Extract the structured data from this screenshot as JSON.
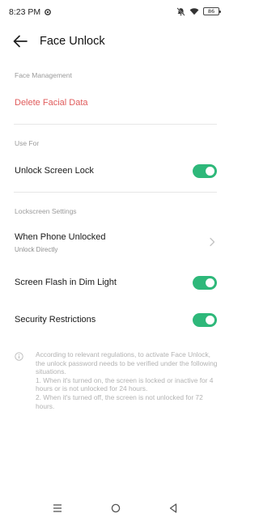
{
  "status_bar": {
    "time": "8:23 PM",
    "battery": "86"
  },
  "header": {
    "title": "Face Unlock"
  },
  "face_management": {
    "section_title": "Face Management",
    "delete_label": "Delete Facial Data"
  },
  "use_for": {
    "section_title": "Use For",
    "unlock_screen_lock": {
      "label": "Unlock Screen Lock",
      "enabled": true
    }
  },
  "lockscreen_settings": {
    "section_title": "Lockscreen Settings",
    "when_phone_unlocked": {
      "label": "When Phone Unlocked",
      "value": "Unlock Directly"
    },
    "screen_flash": {
      "label": "Screen Flash in Dim Light",
      "enabled": true
    },
    "security_restrictions": {
      "label": "Security Restrictions",
      "enabled": true
    }
  },
  "info": {
    "intro": "According to relevant regulations, to activate Face Unlock, the unlock password needs to be verified under the following situations.",
    "item1": "1. When it's turned on, the screen is locked or inactive for 4 hours or is not unlocked for 24 hours.",
    "item2": "2. When it's turned off, the screen is not unlocked for 72 hours."
  },
  "colors": {
    "accent_green": "#2eb87a",
    "danger_red": "#e05b5b"
  }
}
